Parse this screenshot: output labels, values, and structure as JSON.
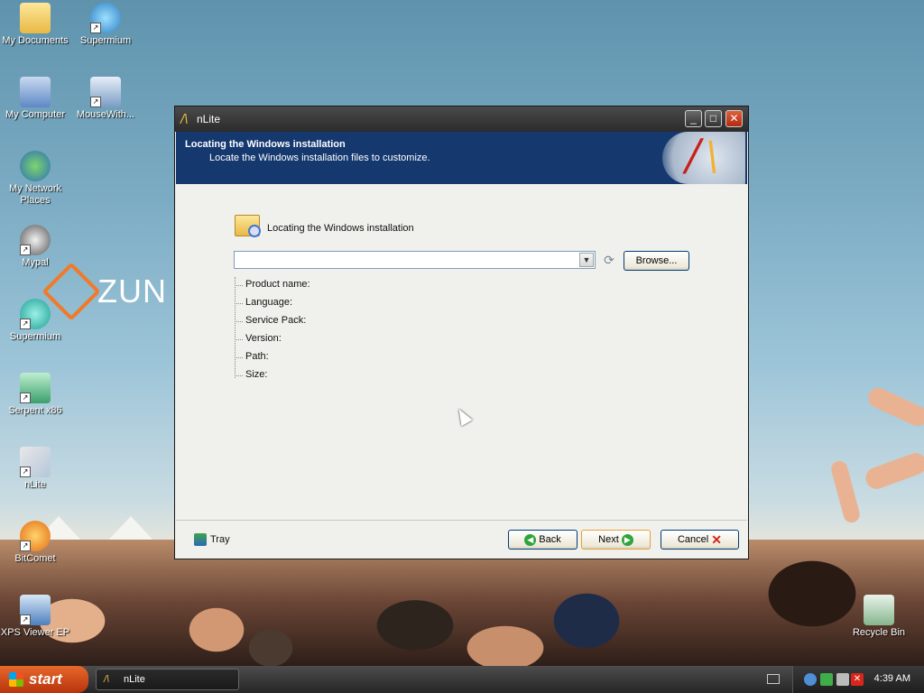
{
  "desktop": {
    "icons": [
      {
        "label": "My Documents"
      },
      {
        "label": "Supermium"
      },
      {
        "label": "My Computer"
      },
      {
        "label": "MouseWith..."
      },
      {
        "label": "My Network Places"
      },
      {
        "label": "Mypal"
      },
      {
        "label": "Supermium"
      },
      {
        "label": "Serpent x86"
      },
      {
        "label": "nLite"
      },
      {
        "label": "BitComet"
      },
      {
        "label": "XPS Viewer EP"
      },
      {
        "label": "Recycle Bin"
      }
    ],
    "wallpaper_text": "ZUN"
  },
  "window": {
    "title": "nLite",
    "header_title": "Locating the Windows installation",
    "header_subtitle": "Locate the Windows installation files to customize.",
    "section_label": "Locating the Windows installation",
    "combo_value": "",
    "browse_label": "Browse...",
    "info": [
      {
        "label": "Product name:"
      },
      {
        "label": "Language:"
      },
      {
        "label": "Service Pack:"
      },
      {
        "label": "Version:"
      },
      {
        "label": "Path:"
      },
      {
        "label": "Size:"
      }
    ],
    "tray_label": "Tray",
    "back_label": "Back",
    "next_label": "Next",
    "cancel_label": "Cancel"
  },
  "taskbar": {
    "start_label": "start",
    "task_label": "nLite",
    "clock": "4:39 AM"
  },
  "colors": {
    "banner": "#15386f",
    "start": "#d1521e",
    "close": "#c93a1c"
  }
}
